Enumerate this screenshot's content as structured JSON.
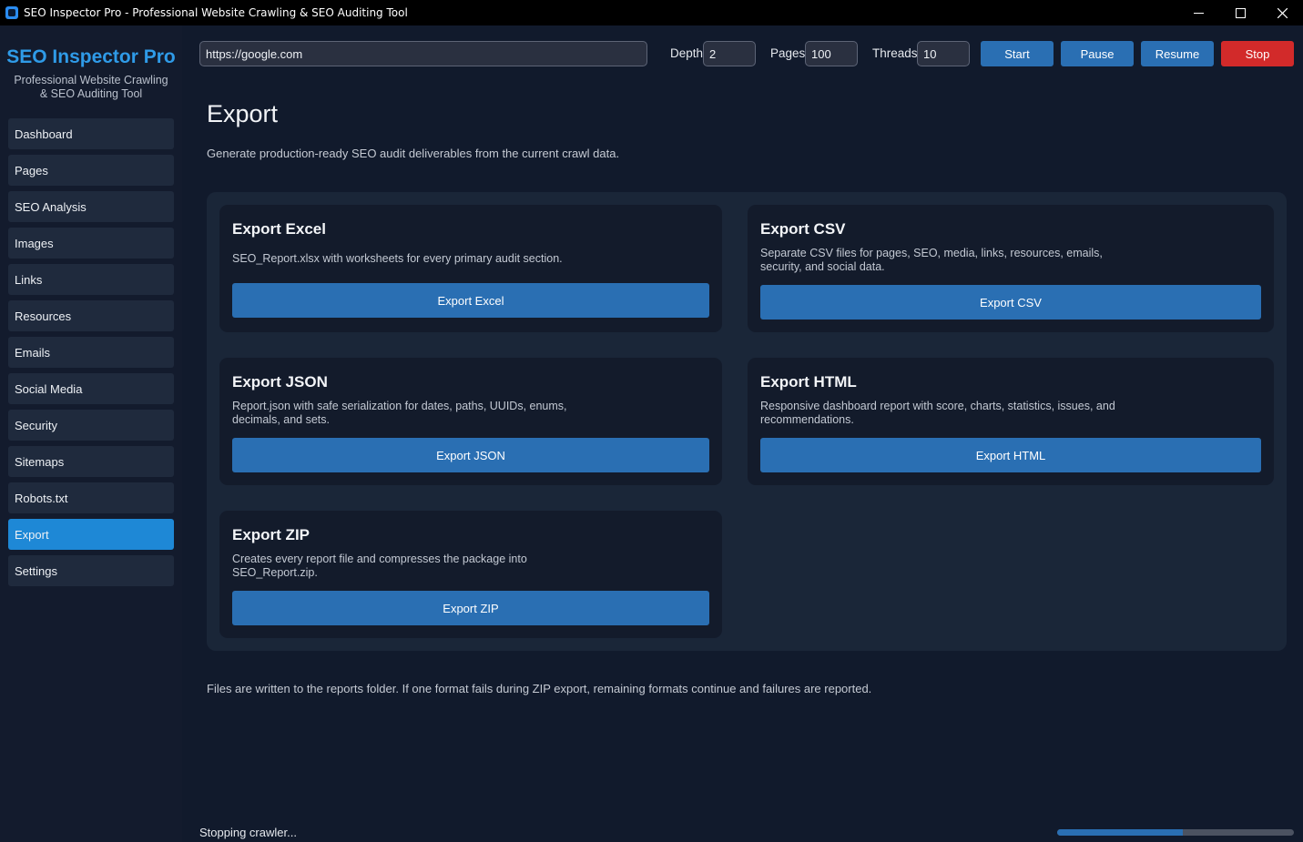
{
  "window": {
    "title": "SEO Inspector Pro - Professional Website Crawling & SEO Auditing Tool",
    "controls": [
      "minimize-icon",
      "maximize-icon",
      "close-icon"
    ]
  },
  "sidebar": {
    "brand": "SEO Inspector Pro",
    "subtitle_line1": "Professional Website Crawling",
    "subtitle_line2": "& SEO Auditing Tool",
    "items": [
      {
        "label": "Dashboard"
      },
      {
        "label": "Pages"
      },
      {
        "label": "SEO Analysis"
      },
      {
        "label": "Images"
      },
      {
        "label": "Links"
      },
      {
        "label": "Resources"
      },
      {
        "label": "Emails"
      },
      {
        "label": "Social Media"
      },
      {
        "label": "Security"
      },
      {
        "label": "Sitemaps"
      },
      {
        "label": "Robots.txt"
      },
      {
        "label": "Export",
        "active": true
      },
      {
        "label": "Settings"
      }
    ]
  },
  "toolbar": {
    "url": "https://google.com",
    "depth_label": "Depth",
    "depth_value": "2",
    "pages_label": "Pages",
    "pages_value": "100",
    "threads_label": "Threads",
    "threads_value": "10",
    "start_label": "Start",
    "pause_label": "Pause",
    "resume_label": "Resume",
    "stop_label": "Stop"
  },
  "main": {
    "title": "Export",
    "description": "Generate production-ready SEO audit deliverables from the current crawl data.",
    "cards": [
      {
        "title": "Export Excel",
        "desc_line1": "SEO_Report.xlsx with worksheets for every primary audit section.",
        "desc_line2": "",
        "button": "Export Excel"
      },
      {
        "title": "Export CSV",
        "desc_line1": "Separate CSV files for pages, SEO, media, links, resources, emails,",
        "desc_line2": "security, and social data.",
        "button": "Export CSV"
      },
      {
        "title": "Export JSON",
        "desc_line1": "Report.json with safe serialization for dates, paths, UUIDs, enums,",
        "desc_line2": "decimals, and sets.",
        "button": "Export JSON"
      },
      {
        "title": "Export HTML",
        "desc_line1": "Responsive dashboard report with score, charts, statistics, issues, and",
        "desc_line2": "recommendations.",
        "button": "Export HTML"
      },
      {
        "title": "Export ZIP",
        "desc_line1": "Creates every report file and compresses the package into",
        "desc_line2": "SEO_Report.zip.",
        "button": "Export ZIP"
      }
    ],
    "footer_note": "Files are written to the reports folder. If one format fails during ZIP export, remaining formats continue and failures are reported."
  },
  "status": {
    "text": "Stopping crawler...",
    "progress_percent": 53
  },
  "colors": {
    "accent": "#2f9be8",
    "button": "#2a6fb3",
    "stop": "#d22a2a",
    "active_nav": "#1e88d6"
  }
}
